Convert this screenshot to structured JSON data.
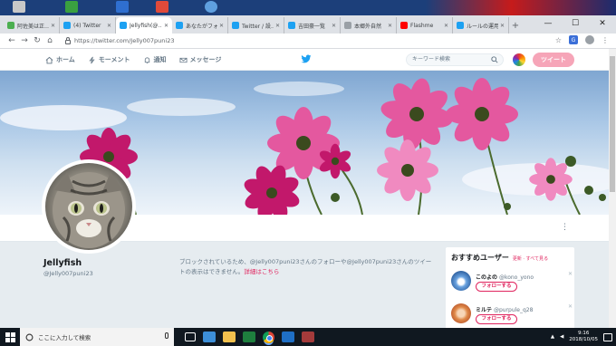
{
  "browser": {
    "tabs": [
      {
        "title": "阿佐美は正…",
        "color": "#4caf50",
        "active": false
      },
      {
        "title": "(4) Twitter",
        "color": "#1da1f2",
        "active": false
      },
      {
        "title": "Jellyfish(@…",
        "color": "#1da1f2",
        "active": true
      },
      {
        "title": "あなたがフォ…",
        "color": "#1da1f2",
        "active": false
      },
      {
        "title": "Twitter / 設…",
        "color": "#1da1f2",
        "active": false
      },
      {
        "title": "吉田豪一覧",
        "color": "#1da1f2",
        "active": false
      },
      {
        "title": "本郷外自然",
        "color": "#9aa0a6",
        "active": false
      },
      {
        "title": "Flashme",
        "color": "#ff0000",
        "active": false
      },
      {
        "title": "ルールの運用",
        "color": "#1da1f2",
        "active": false
      }
    ],
    "new_tab": "+",
    "url": "https://twitter.com/Jelly007puni23",
    "window_controls": {
      "minimize": "—",
      "maximize": "☐",
      "close": "✕"
    }
  },
  "twitter_nav": {
    "home": "ホーム",
    "moments": "モーメント",
    "notifications": "通知",
    "messages": "メッセージ",
    "search_placeholder": "キーワード検索",
    "tweet_button": "ツイート"
  },
  "profile": {
    "name": "Jellyfish",
    "handle": "@Jelly007puni23",
    "more_menu": "⋮",
    "blocked_message": "ブロックされているため、@Jelly007puni23さんのフォローや@Jelly007puni23さんのツイートの表示はできません。",
    "blocked_link": "詳細はこちら"
  },
  "who_to_follow": {
    "title": "おすすめユーザー",
    "links": "更新 · すべて見る",
    "users": [
      {
        "name": "このよの",
        "handle": "@kono_yono",
        "follow": "フォローする",
        "avatar_color": "#2c5e9e"
      },
      {
        "name": "ミルテ",
        "handle": "@purpule_q28",
        "follow": "フォローする",
        "avatar_color": "#d9733a"
      }
    ]
  },
  "taskbar": {
    "search_placeholder": "ここに入力して検索",
    "time": "9:16",
    "date": "2018/10/05"
  },
  "colors": {
    "twitter_blue": "#1da1f2",
    "accent_pink": "#e0245e",
    "tweet_button": "#f6a5b8"
  }
}
